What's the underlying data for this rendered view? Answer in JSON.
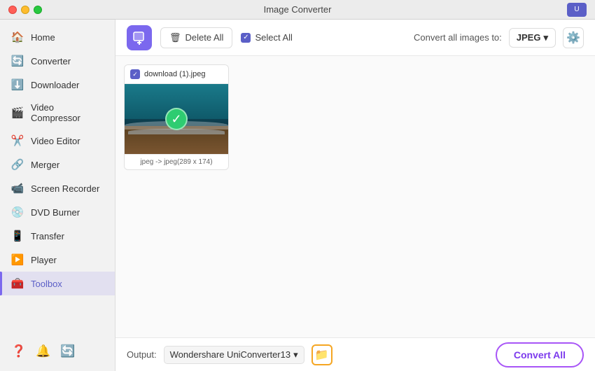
{
  "titleBar": {
    "title": "Image Converter"
  },
  "sidebar": {
    "items": [
      {
        "id": "home",
        "label": "Home",
        "icon": "🏠"
      },
      {
        "id": "converter",
        "label": "Converter",
        "icon": "🔄"
      },
      {
        "id": "downloader",
        "label": "Downloader",
        "icon": "⬇️"
      },
      {
        "id": "video-compressor",
        "label": "Video Compressor",
        "icon": "🎬"
      },
      {
        "id": "video-editor",
        "label": "Video Editor",
        "icon": "✂️"
      },
      {
        "id": "merger",
        "label": "Merger",
        "icon": "🔗"
      },
      {
        "id": "screen-recorder",
        "label": "Screen Recorder",
        "icon": "📹"
      },
      {
        "id": "dvd-burner",
        "label": "DVD Burner",
        "icon": "💿"
      },
      {
        "id": "transfer",
        "label": "Transfer",
        "icon": "📱"
      },
      {
        "id": "player",
        "label": "Player",
        "icon": "▶️"
      },
      {
        "id": "toolbox",
        "label": "Toolbox",
        "icon": "🧰",
        "active": true
      }
    ],
    "bottomIcons": [
      {
        "id": "help",
        "icon": "❓"
      },
      {
        "id": "notifications",
        "icon": "🔔"
      },
      {
        "id": "settings",
        "icon": "🔄"
      }
    ]
  },
  "toolbar": {
    "deleteAllLabel": "Delete All",
    "selectAllLabel": "Select All",
    "convertToLabel": "Convert all images to:",
    "format": "JPEG",
    "addIcon": "+"
  },
  "fileArea": {
    "files": [
      {
        "name": "download (1).jpeg",
        "format": "jpeg",
        "outputFormat": "jpeg",
        "dimensions": "289 x 174"
      }
    ]
  },
  "bottomBar": {
    "outputLabel": "Output:",
    "outputPath": "Wondershare UniConverter13",
    "convertAllLabel": "Convert All"
  }
}
